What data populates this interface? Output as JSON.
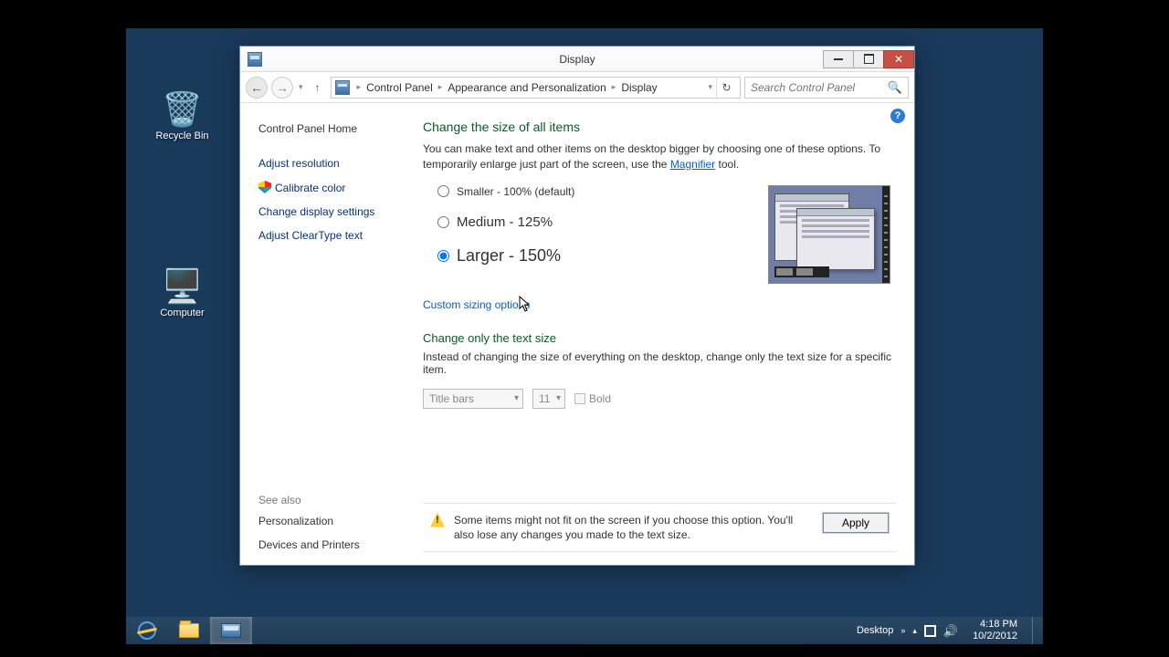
{
  "window": {
    "title": "Display",
    "breadcrumb": [
      "Control Panel",
      "Appearance and Personalization",
      "Display"
    ],
    "search_placeholder": "Search Control Panel"
  },
  "sidebar": {
    "home": "Control Panel Home",
    "links": [
      "Adjust resolution",
      "Calibrate color",
      "Change display settings",
      "Adjust ClearType text"
    ],
    "see_also_label": "See also",
    "see_also": [
      "Personalization",
      "Devices and Printers"
    ]
  },
  "main": {
    "heading1": "Change the size of all items",
    "desc1_pre": "You can make text and other items on the desktop bigger by choosing one of these options. To temporarily enlarge just part of the screen, use the ",
    "desc1_link": "Magnifier",
    "desc1_post": " tool.",
    "options": {
      "small": "Smaller - 100% (default)",
      "medium": "Medium - 125%",
      "large": "Larger - 150%"
    },
    "selected": "large",
    "custom_link": "Custom sizing options",
    "heading2": "Change only the text size",
    "desc2": "Instead of changing the size of everything on the desktop, change only the text size for a specific item.",
    "item_select": "Title bars",
    "size_select": "11",
    "bold_label": "Bold",
    "warning": "Some items might not fit on the screen if you choose this option. You'll also lose any changes you made to the text size.",
    "apply_label": "Apply"
  },
  "desktop": {
    "recycle": "Recycle Bin",
    "computer": "Computer"
  },
  "taskbar": {
    "desktop_label": "Desktop",
    "time": "4:18 PM",
    "date": "10/2/2012"
  }
}
